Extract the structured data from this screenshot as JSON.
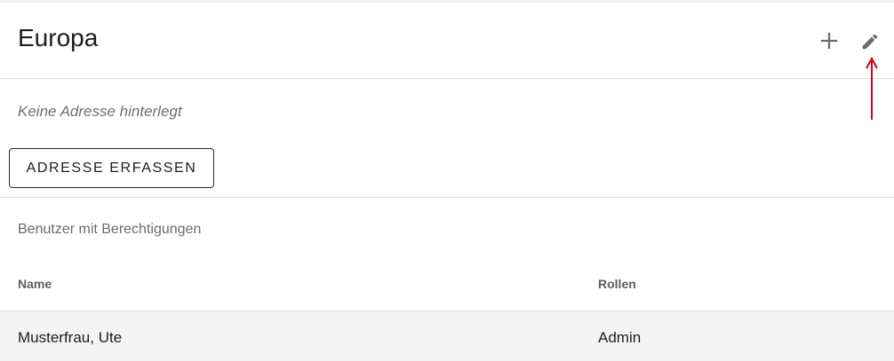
{
  "header": {
    "title": "Europa"
  },
  "address": {
    "empty_text": "Keine Adresse hinterlegt",
    "button_label": "ADRESSE ERFASSEN"
  },
  "permissions": {
    "section_title": "Benutzer mit Berechtigungen",
    "columns": [
      "Name",
      "Rollen"
    ],
    "rows": [
      {
        "name": "Musterfrau, Ute",
        "role": "Admin"
      }
    ]
  },
  "icons": {
    "add": "plus-icon",
    "edit": "pencil-icon",
    "annotation": "red-arrow-up"
  },
  "colors": {
    "annotation_arrow": "#d0021b",
    "icon_gray": "#6a6a6a"
  }
}
